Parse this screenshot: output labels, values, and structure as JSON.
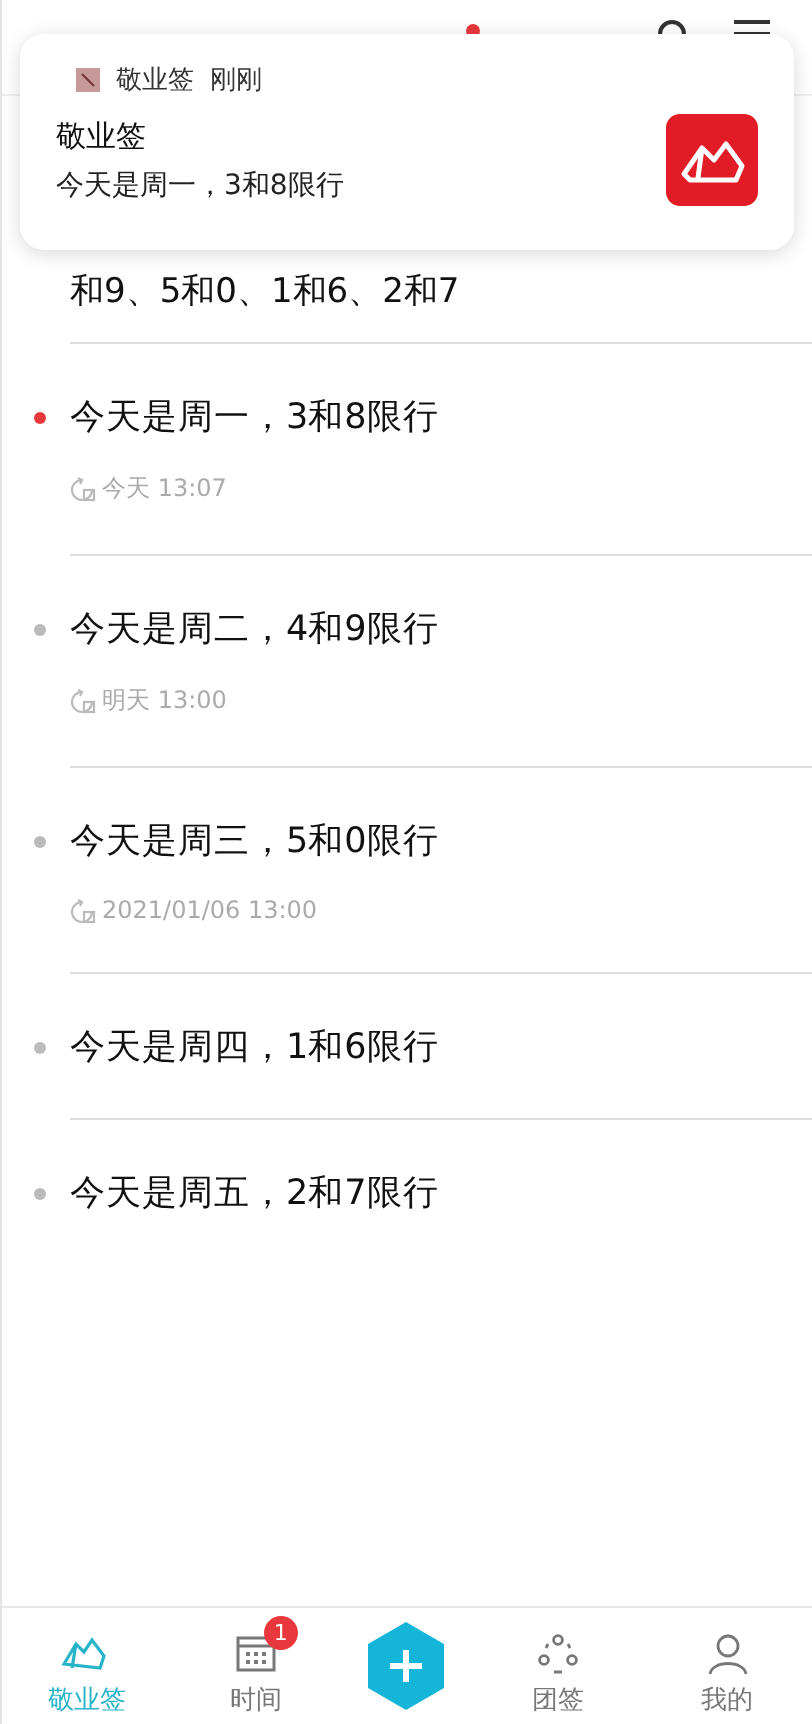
{
  "header": {
    "unread": true
  },
  "notification": {
    "app": "敬业签",
    "time": "刚刚",
    "title": "敬业签",
    "body": "今天是周一，3和8限行"
  },
  "list": {
    "continued_text": "和9、5和0、1和6、2和7",
    "items": [
      {
        "title": "今天是周一，3和8限行",
        "color": "#e8383d",
        "time": "今天 13:07"
      },
      {
        "title": "今天是周二，4和9限行",
        "color": "#bbbbbb",
        "time": "明天 13:00"
      },
      {
        "title": "今天是周三，5和0限行",
        "color": "#bbbbbb",
        "time": "2021/01/06 13:00"
      },
      {
        "title": "今天是周四，1和6限行",
        "color": "#bbbbbb"
      },
      {
        "title": "今天是周五，2和7限行",
        "color": "#bbbbbb"
      }
    ]
  },
  "tabbar": [
    {
      "kind": "notes",
      "label": "敬业签",
      "selected": true
    },
    {
      "kind": "calendar",
      "label": "时间",
      "selected": false,
      "badge": "1"
    },
    {
      "kind": "add"
    },
    {
      "kind": "team",
      "label": "团签",
      "selected": false
    },
    {
      "kind": "profile",
      "label": "我的",
      "selected": false
    }
  ]
}
